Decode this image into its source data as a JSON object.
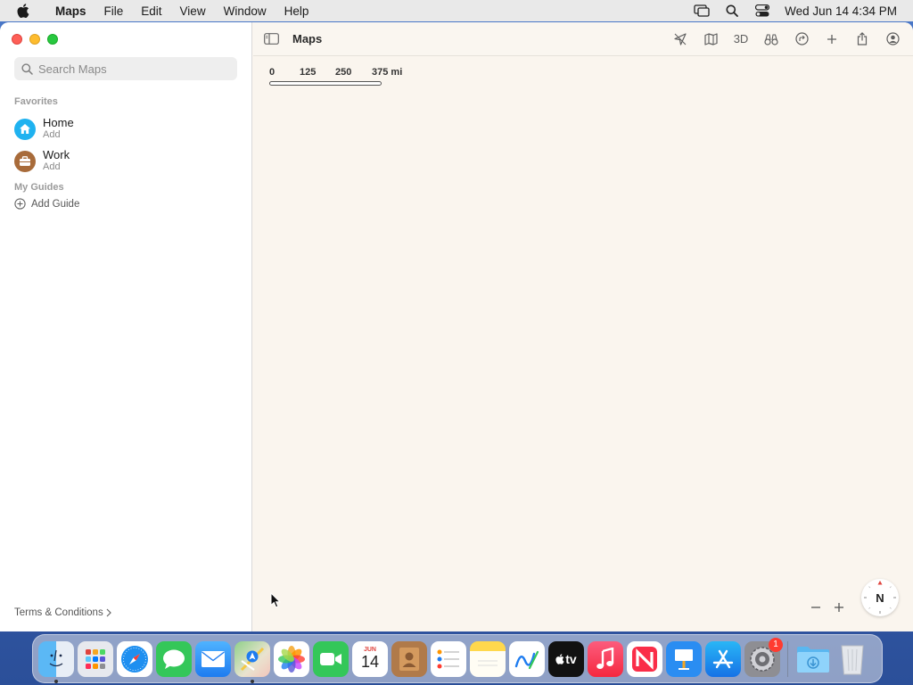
{
  "menubar": {
    "app": "Maps",
    "items": [
      "File",
      "Edit",
      "View",
      "Window",
      "Help"
    ],
    "clock": "Wed Jun 14  4:34 PM"
  },
  "toolbar": {
    "title": "Maps",
    "view_3d": "3D"
  },
  "sidebar": {
    "search_placeholder": "Search Maps",
    "favorites_label": "Favorites",
    "favorites": [
      {
        "title": "Home",
        "subtitle": "Add",
        "color": "#1fb2f0"
      },
      {
        "title": "Work",
        "subtitle": "Add",
        "color": "#a86b3a"
      }
    ],
    "guides_label": "My Guides",
    "add_guide": "Add Guide",
    "terms": "Terms & Conditions"
  },
  "map": {
    "scale_labels": [
      "0",
      "125",
      "250",
      "375 mi"
    ],
    "compass_label": "N"
  },
  "dock": {
    "calendar_month": "JUN",
    "calendar_day": "14",
    "tv_label": "tv",
    "settings_badge": "1"
  }
}
